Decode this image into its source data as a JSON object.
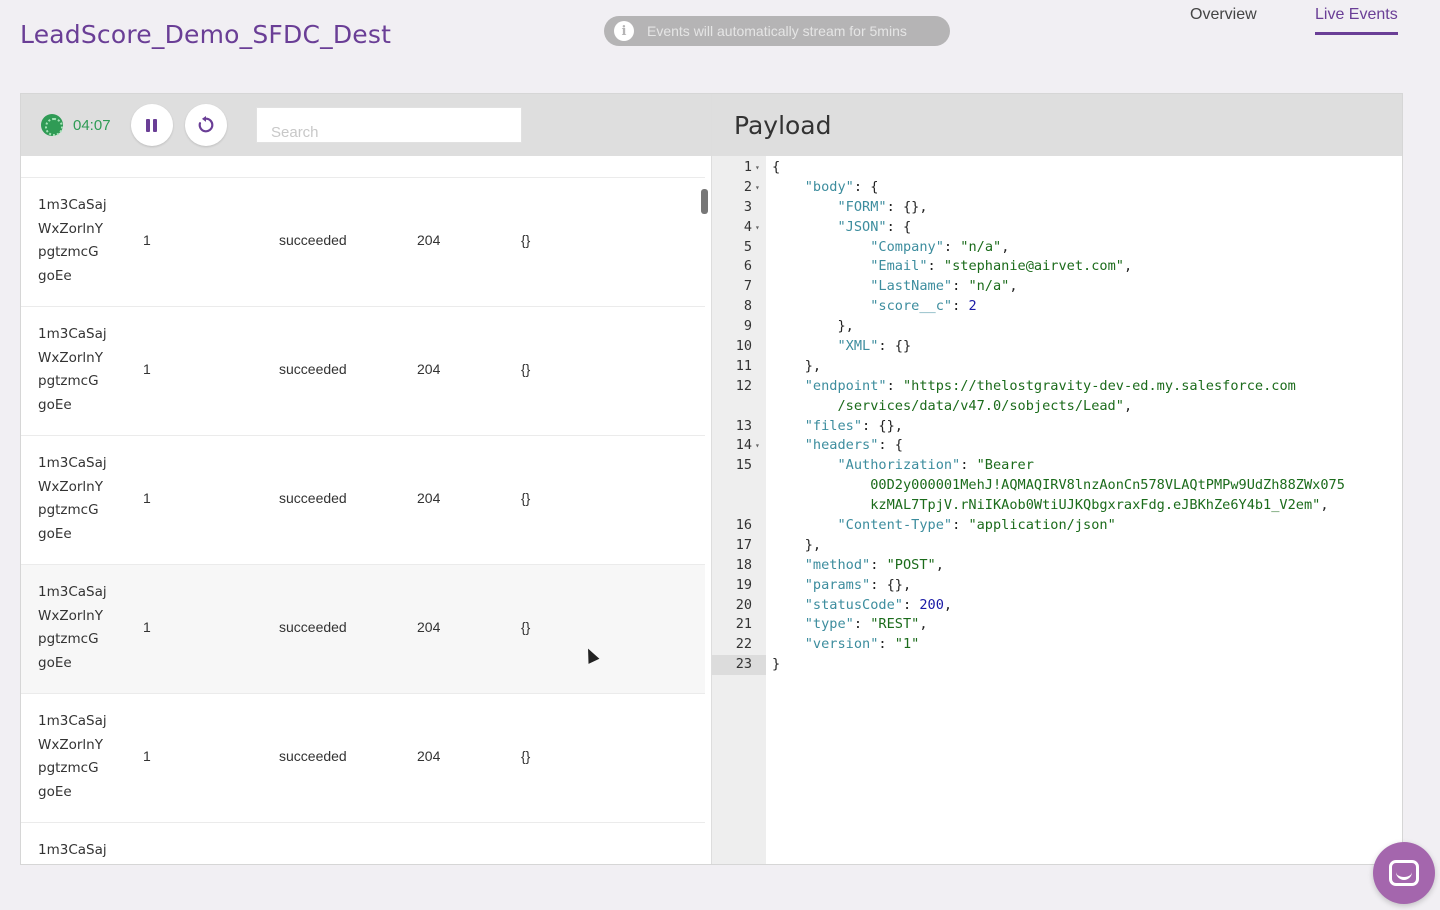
{
  "app": {
    "title": "LeadScore_Demo_SFDC_Dest"
  },
  "banner": {
    "icon": "info-icon",
    "text": "Events will automatically stream for 5mins"
  },
  "nav": {
    "tabs": [
      {
        "label": "Overview",
        "active": false
      },
      {
        "label": "Live Events",
        "active": true
      }
    ]
  },
  "colors": {
    "accent": "#6a3e96",
    "timer": "#2f9b55",
    "chat": "#a466ad"
  },
  "toolbar": {
    "timer": "04:07",
    "timer_icon": "clock-icon",
    "pause_icon": "pause-icon",
    "replay_icon": "replay-icon",
    "search_placeholder": "Search"
  },
  "events": [
    {
      "id_lines": [
        "1m3CaSaj",
        "WxZorlnY",
        "pgtzmcG",
        "goEe"
      ],
      "count": "1",
      "status": "succeeded",
      "code": "204",
      "response": "{}"
    },
    {
      "id_lines": [
        "1m3CaSaj",
        "WxZorlnY",
        "pgtzmcG",
        "goEe"
      ],
      "count": "1",
      "status": "succeeded",
      "code": "204",
      "response": "{}"
    },
    {
      "id_lines": [
        "1m3CaSaj",
        "WxZorlnY",
        "pgtzmcG",
        "goEe"
      ],
      "count": "1",
      "status": "succeeded",
      "code": "204",
      "response": "{}"
    },
    {
      "id_lines": [
        "1m3CaSaj",
        "WxZorlnY",
        "pgtzmcG",
        "goEe"
      ],
      "count": "1",
      "status": "succeeded",
      "code": "204",
      "response": "{}"
    },
    {
      "id_lines": [
        "1m3CaSaj",
        "WxZorlnY",
        "pgtzmcG",
        "goEe"
      ],
      "count": "1",
      "status": "succeeded",
      "code": "204",
      "response": "{}"
    },
    {
      "id_lines": [
        "1m3CaSaj"
      ],
      "count": "",
      "status": "",
      "code": "",
      "response": ""
    }
  ],
  "payload": {
    "title": "Payload",
    "lines": [
      {
        "n": "1",
        "fold": true,
        "segments": [
          [
            "p",
            "{"
          ]
        ]
      },
      {
        "n": "2",
        "fold": true,
        "segments": [
          [
            "p",
            "    "
          ],
          [
            "k",
            "\"body\""
          ],
          [
            "p",
            ": {"
          ]
        ]
      },
      {
        "n": "3",
        "fold": false,
        "segments": [
          [
            "p",
            "        "
          ],
          [
            "k",
            "\"FORM\""
          ],
          [
            "p",
            ": {},"
          ]
        ]
      },
      {
        "n": "4",
        "fold": true,
        "segments": [
          [
            "p",
            "        "
          ],
          [
            "k",
            "\"JSON\""
          ],
          [
            "p",
            ": {"
          ]
        ]
      },
      {
        "n": "5",
        "fold": false,
        "segments": [
          [
            "p",
            "            "
          ],
          [
            "k",
            "\"Company\""
          ],
          [
            "p",
            ": "
          ],
          [
            "s",
            "\"n/a\""
          ],
          [
            "p",
            ","
          ]
        ]
      },
      {
        "n": "6",
        "fold": false,
        "segments": [
          [
            "p",
            "            "
          ],
          [
            "k",
            "\"Email\""
          ],
          [
            "p",
            ": "
          ],
          [
            "s",
            "\"stephanie@airvet.com\""
          ],
          [
            "p",
            ","
          ]
        ]
      },
      {
        "n": "7",
        "fold": false,
        "segments": [
          [
            "p",
            "            "
          ],
          [
            "k",
            "\"LastName\""
          ],
          [
            "p",
            ": "
          ],
          [
            "s",
            "\"n/a\""
          ],
          [
            "p",
            ","
          ]
        ]
      },
      {
        "n": "8",
        "fold": false,
        "segments": [
          [
            "p",
            "            "
          ],
          [
            "k",
            "\"score__c\""
          ],
          [
            "p",
            ": "
          ],
          [
            "n",
            "2"
          ]
        ]
      },
      {
        "n": "9",
        "fold": false,
        "segments": [
          [
            "p",
            "        },"
          ]
        ]
      },
      {
        "n": "10",
        "fold": false,
        "segments": [
          [
            "p",
            "        "
          ],
          [
            "k",
            "\"XML\""
          ],
          [
            "p",
            ": {}"
          ]
        ]
      },
      {
        "n": "11",
        "fold": false,
        "segments": [
          [
            "p",
            "    },"
          ]
        ]
      },
      {
        "n": "12",
        "fold": false,
        "segments": [
          [
            "p",
            "    "
          ],
          [
            "k",
            "\"endpoint\""
          ],
          [
            "p",
            ": "
          ],
          [
            "s",
            "\"https://thelostgravity-dev-ed.my.salesforce.com"
          ]
        ]
      },
      {
        "n": "",
        "fold": false,
        "segments": [
          [
            "p",
            "        "
          ],
          [
            "s",
            "/services/data/v47.0/sobjects/Lead\""
          ],
          [
            "p",
            ","
          ]
        ]
      },
      {
        "n": "13",
        "fold": false,
        "segments": [
          [
            "p",
            "    "
          ],
          [
            "k",
            "\"files\""
          ],
          [
            "p",
            ": {},"
          ]
        ]
      },
      {
        "n": "14",
        "fold": true,
        "segments": [
          [
            "p",
            "    "
          ],
          [
            "k",
            "\"headers\""
          ],
          [
            "p",
            ": {"
          ]
        ]
      },
      {
        "n": "15",
        "fold": false,
        "segments": [
          [
            "p",
            "        "
          ],
          [
            "k",
            "\"Authorization\""
          ],
          [
            "p",
            ": "
          ],
          [
            "s",
            "\"Bearer"
          ]
        ]
      },
      {
        "n": "",
        "fold": false,
        "segments": [
          [
            "p",
            "            "
          ],
          [
            "s",
            "00D2y000001MehJ!AQMAQIRV8lnzAonCn578VLAQtPMPw9UdZh88ZWx075"
          ]
        ]
      },
      {
        "n": "",
        "fold": false,
        "segments": [
          [
            "p",
            "            "
          ],
          [
            "s",
            "kzMAL7TpjV.rNiIKAob0WtiUJKQbgxraxFdg.eJBKhZe6Y4b1_V2em\""
          ],
          [
            "p",
            ","
          ]
        ]
      },
      {
        "n": "16",
        "fold": false,
        "segments": [
          [
            "p",
            "        "
          ],
          [
            "k",
            "\"Content-Type\""
          ],
          [
            "p",
            ": "
          ],
          [
            "s",
            "\"application/json\""
          ]
        ]
      },
      {
        "n": "17",
        "fold": false,
        "segments": [
          [
            "p",
            "    },"
          ]
        ]
      },
      {
        "n": "18",
        "fold": false,
        "segments": [
          [
            "p",
            "    "
          ],
          [
            "k",
            "\"method\""
          ],
          [
            "p",
            ": "
          ],
          [
            "s",
            "\"POST\""
          ],
          [
            "p",
            ","
          ]
        ]
      },
      {
        "n": "19",
        "fold": false,
        "segments": [
          [
            "p",
            "    "
          ],
          [
            "k",
            "\"params\""
          ],
          [
            "p",
            ": {},"
          ]
        ]
      },
      {
        "n": "20",
        "fold": false,
        "segments": [
          [
            "p",
            "    "
          ],
          [
            "k",
            "\"statusCode\""
          ],
          [
            "p",
            ": "
          ],
          [
            "n",
            "200"
          ],
          [
            "p",
            ","
          ]
        ]
      },
      {
        "n": "21",
        "fold": false,
        "segments": [
          [
            "p",
            "    "
          ],
          [
            "k",
            "\"type\""
          ],
          [
            "p",
            ": "
          ],
          [
            "s",
            "\"REST\""
          ],
          [
            "p",
            ","
          ]
        ]
      },
      {
        "n": "22",
        "fold": false,
        "segments": [
          [
            "p",
            "    "
          ],
          [
            "k",
            "\"version\""
          ],
          [
            "p",
            ": "
          ],
          [
            "s",
            "\"1\""
          ]
        ]
      },
      {
        "n": "23",
        "fold": false,
        "active": true,
        "segments": [
          [
            "p",
            "}"
          ]
        ]
      }
    ]
  },
  "chat": {
    "icon": "chat-icon"
  }
}
